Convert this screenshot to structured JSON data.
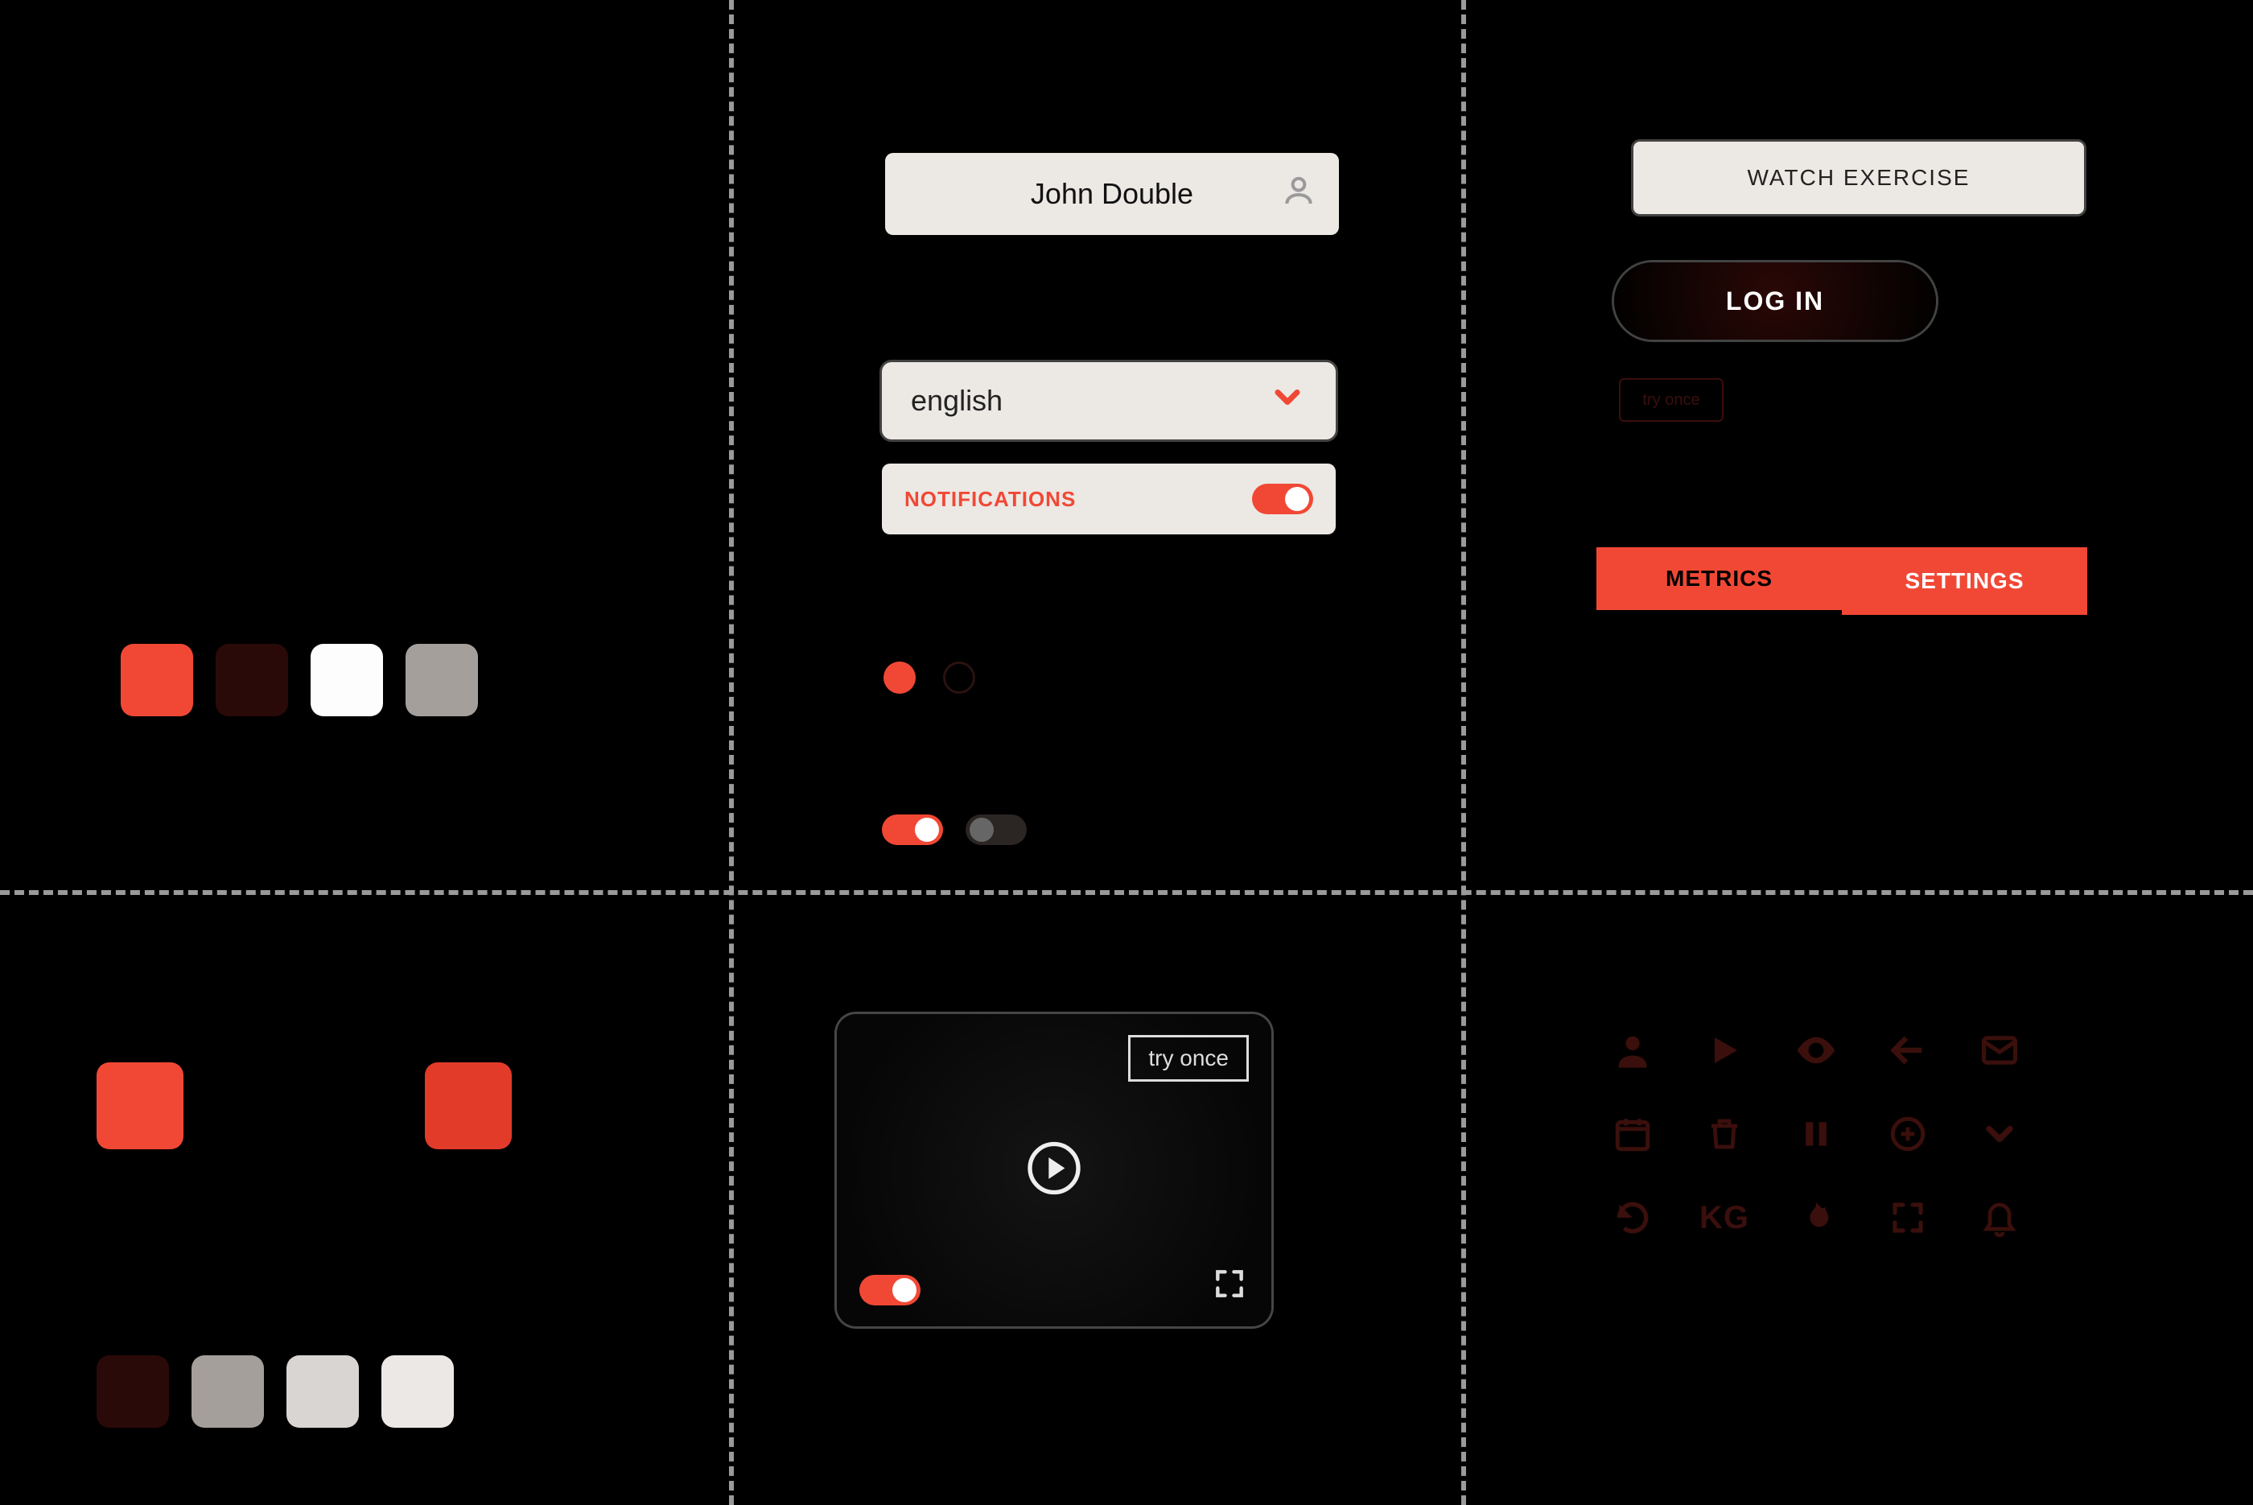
{
  "palette": {
    "primary": "#f14835",
    "darkRed": "#2a0a08",
    "white": "#fdfdfd",
    "grey": "#a59f9c",
    "lightGrey1": "#b3afac",
    "lightGrey2": "#d8d5d2",
    "lightGrey3": "#ebe8e5"
  },
  "swatchesTop": {
    "row": [
      {
        "hex": "#f14835"
      },
      {
        "hex": "#2a0a08"
      },
      {
        "hex": "#fdfdfd"
      },
      {
        "hex": "#a59f9c"
      }
    ]
  },
  "swatchesBottom": {
    "row1": [
      {
        "hex": "#f14835"
      },
      {
        "hex": "#e23b2a"
      }
    ],
    "row2": [
      {
        "hex": "#2a0a08"
      },
      {
        "hex": "#a59f9c"
      },
      {
        "hex": "#d8d5d2"
      },
      {
        "hex": "#ebe8e5"
      }
    ]
  },
  "profile": {
    "name": "John Double"
  },
  "languageSelect": {
    "value": "english"
  },
  "notifications": {
    "label": "NOTIFICATIONS",
    "enabled": true
  },
  "radios": {
    "selectedIndex": 0
  },
  "toggles": {
    "left": true,
    "right": false
  },
  "buttons": {
    "watchExercise": "WATCH EXERCISE",
    "login": "LOG IN",
    "smallHidden": "try once"
  },
  "tabs": {
    "left": "METRICS",
    "right": "SETTINGS",
    "active": "METRICS"
  },
  "videoCard": {
    "tryOnce": "try once",
    "toggle": true
  },
  "iconGrid": {
    "kg": "KG"
  }
}
